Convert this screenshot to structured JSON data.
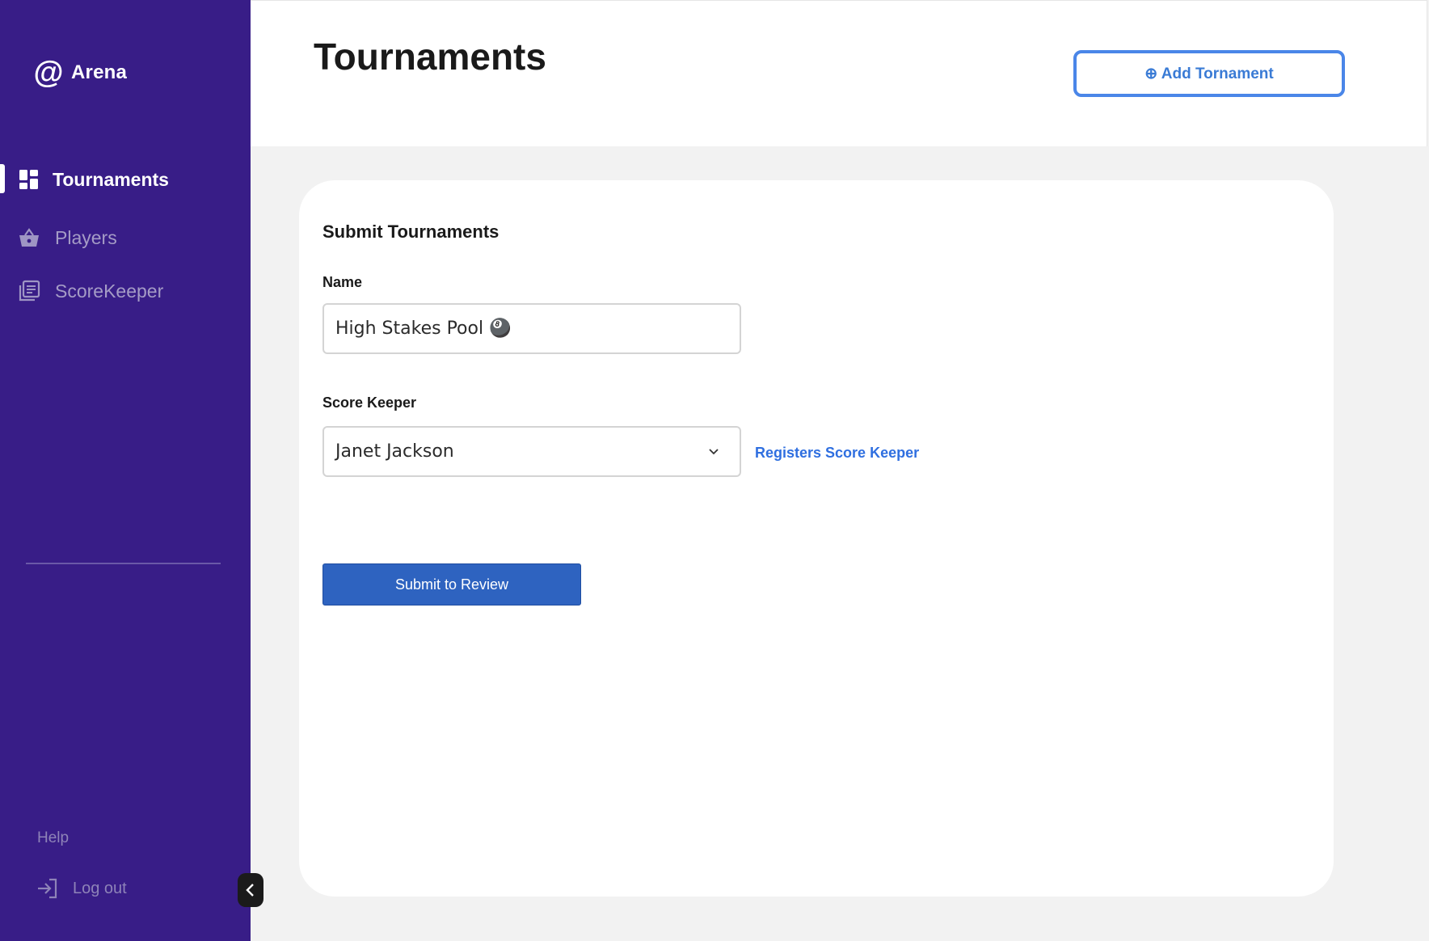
{
  "sidebar": {
    "logo_symbol": "@",
    "logo_text": "Arena",
    "items": [
      {
        "label": "Tournaments",
        "icon": "dashboard-icon",
        "active": true
      },
      {
        "label": "Players",
        "icon": "basket-icon",
        "active": false
      },
      {
        "label": "ScoreKeeper",
        "icon": "library-icon",
        "active": false
      }
    ],
    "help_label": "Help",
    "logout_label": "Log out"
  },
  "header": {
    "title": "Tournaments",
    "add_button_label": "⊕ Add Tornament"
  },
  "form": {
    "card_title": "Submit Tournaments",
    "name_label": "Name",
    "name_value": "High Stakes Pool 🎱",
    "score_keeper_label": "Score Keeper",
    "score_keeper_value": "Janet Jackson",
    "register_link": "Registers Score Keeper",
    "submit_label": "Submit to Review"
  },
  "colors": {
    "sidebar_bg": "#381d87",
    "accent": "#4a86e8",
    "submit_bg": "#2e63c0"
  }
}
